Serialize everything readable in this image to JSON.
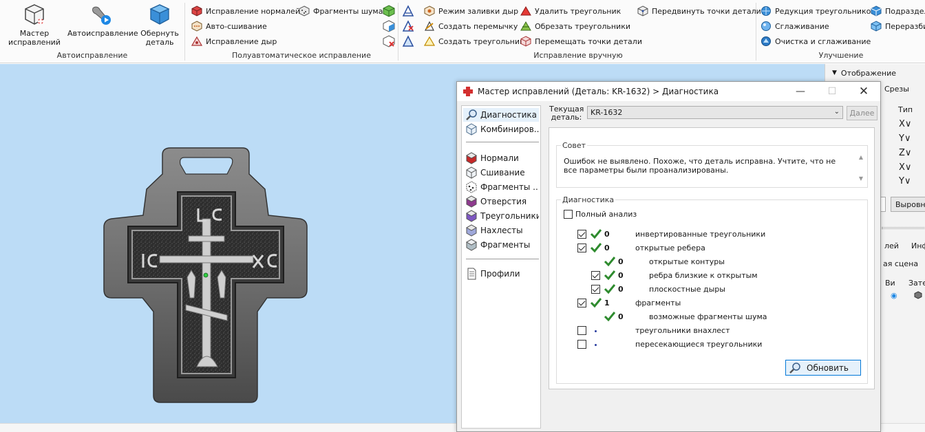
{
  "ribbon": {
    "groups": {
      "autofix": {
        "label": "Автоисправление",
        "buttons": [
          {
            "label": "Мастер\nисправлений",
            "icon": "wizard-cube-icon"
          },
          {
            "label": "Автоисправление",
            "icon": "wrench-play-icon"
          },
          {
            "label": "Обернуть\nдеталь",
            "icon": "wrap-cube-icon"
          }
        ]
      },
      "semi": {
        "label": "Полуавтоматическое исправление",
        "buttons": [
          "Исправление нормалей",
          "Авто-сшивание",
          "Исправление дыр",
          "Фрагменты шума"
        ]
      },
      "manual": {
        "label": "Исправление вручную",
        "buttons": [
          "Режим заливки дыр",
          "Создать перемычку",
          "Создать треугольник",
          "Удалить треугольник",
          "Обрезать треугольники",
          "Перемещать точки детали",
          "Передвинуть точки детали"
        ]
      },
      "improve": {
        "label": "Улучшение",
        "buttons": [
          "Редукция треугольников",
          "Сглаживание",
          "Очистка и сглаживание",
          "Подраздел",
          "Переразби"
        ]
      }
    }
  },
  "right_panel": {
    "header": "Отображение",
    "tab_slices": "Срезы",
    "col_type": "Тип",
    "axes": [
      "X∨",
      "Y∨",
      "Z∨",
      "X∨",
      "Y∨"
    ],
    "select_btn": "Выровнь",
    "tabs": [
      "лей",
      "Инф"
    ],
    "scene": "ая сцена",
    "cols": [
      "Ви",
      "Зате"
    ]
  },
  "dialog": {
    "title": "Мастер исправлений (Деталь: KR-1632) > Диагностика",
    "nav": {
      "top": [
        "Диагностика",
        "Комбиниров..."
      ],
      "mid": [
        "Нормали",
        "Сшивание",
        "Фрагменты ...",
        "Отверстия",
        "Треугольники",
        "Нахлесты",
        "Фрагменты"
      ],
      "bottom": [
        "Профили"
      ]
    },
    "current_part_label": "Текущая\nдеталь:",
    "current_part": "KR-1632",
    "next_button": "Далее",
    "advice": {
      "legend": "Совет",
      "text": "Ошибок не выявлено. Похоже, что деталь исправна. Учтите, что не все параметры были проанализированы."
    },
    "diagnostics": {
      "legend": "Диагностика",
      "full_analysis": "Полный анализ",
      "rows": [
        {
          "count": "0",
          "label": "инвертированные треугольники"
        },
        {
          "count": "0",
          "label": "открытые ребера"
        },
        {
          "count": "0",
          "label": "открытые контуры"
        },
        {
          "count": "0",
          "label": "ребра близкие к открытым"
        },
        {
          "count": "0",
          "label": "плоскостные дыры"
        },
        {
          "count": "1",
          "label": "фрагменты"
        },
        {
          "count": "0",
          "label": "возможные фрагменты шума"
        },
        {
          "count": "",
          "label": "треугольники внахлест"
        },
        {
          "count": "",
          "label": "пересекающиеся треугольники"
        }
      ]
    },
    "refresh_button": "Обновить"
  },
  "colors": {
    "viewport_bg": "#bcdcf6",
    "check_green": "#2e8b2e",
    "accent": "#0078d7"
  }
}
